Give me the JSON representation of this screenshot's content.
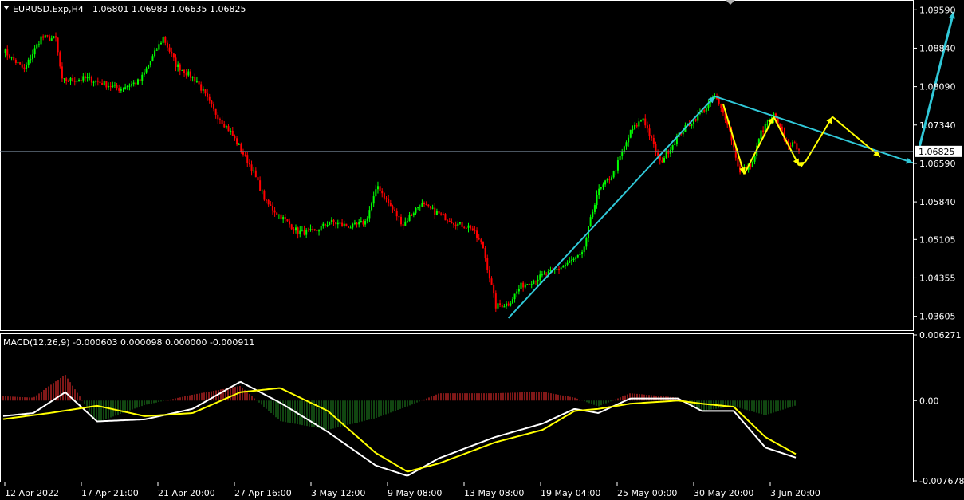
{
  "header": {
    "symbol": "EURUSD.Exp,H4",
    "ohlc": "1.06801 1.06983 1.06635 1.06825"
  },
  "macd_header": {
    "label": "MACD(12,26,9) -0.000603 0.000098 0.000000 -0.000911"
  },
  "colors": {
    "background": "#000000",
    "frame": "#ffffff",
    "bull": "#00ff00",
    "bear": "#ff0000",
    "bid_line": "#778899",
    "trend_cyan": "#30c8d8",
    "zigzag_yellow": "#ffff00",
    "macd_line": "#ffffff",
    "signal_line": "#ffff00",
    "hist_pos": "#ff3030",
    "hist_neg": "#228b22"
  },
  "chart_data": [
    {
      "type": "candlestick",
      "title": "EURUSD.Exp,H4",
      "ylim": [
        1.0335,
        1.0975
      ],
      "y_ticks": [
        "1.09590",
        "1.08840",
        "1.08090",
        "1.07340",
        "1.06590",
        "1.05840",
        "1.05105",
        "1.04355",
        "1.03605"
      ],
      "current_price": "1.06825",
      "x_ticks": [
        "12 Apr 2022",
        "17 Apr 21:00",
        "21 Apr 20:00",
        "27 Apr 16:00",
        "3 May 12:00",
        "9 May 08:00",
        "13 May 08:00",
        "19 May 04:00",
        "25 May 00:00",
        "30 May 20:00",
        "3 Jun 20:00"
      ],
      "bars_count": 250,
      "close_path": [
        [
          0,
          1.088
        ],
        [
          10,
          1.0842
        ],
        [
          18,
          1.0905
        ],
        [
          25,
          1.0902
        ],
        [
          28,
          1.082
        ],
        [
          40,
          1.0825
        ],
        [
          55,
          1.0805
        ],
        [
          65,
          1.082
        ],
        [
          76,
          1.0905
        ],
        [
          82,
          1.0852
        ],
        [
          92,
          1.082
        ],
        [
          100,
          1.0762
        ],
        [
          108,
          1.072
        ],
        [
          118,
          1.065
        ],
        [
          125,
          1.0582
        ],
        [
          132,
          1.0555
        ],
        [
          140,
          1.0525
        ],
        [
          148,
          1.0525
        ],
        [
          155,
          1.0545
        ],
        [
          160,
          1.054
        ],
        [
          166,
          1.0535
        ],
        [
          172,
          1.0545
        ],
        [
          178,
          1.0615
        ],
        [
          184,
          1.0575
        ],
        [
          190,
          1.054
        ],
        [
          198,
          1.058
        ],
        [
          208,
          1.0558
        ],
        [
          216,
          1.054
        ],
        [
          222,
          1.0535
        ],
        [
          228,
          1.0495
        ],
        [
          234,
          1.038
        ],
        [
          240,
          1.0385
        ],
        [
          246,
          1.042
        ]
      ],
      "close_path_note_free": true
    },
    {
      "type": "line",
      "title": "MACD(12,26,9)",
      "ylim": [
        -0.007678,
        0.006271
      ],
      "y_ticks": [
        "0.006271",
        "0.00",
        "-0.007678"
      ],
      "series": [
        {
          "name": "",
          "role": "macd",
          "points": [
            [
              0.0,
              -0.0015
            ],
            [
              0.04,
              -0.0012
            ],
            [
              0.08,
              0.0008
            ],
            [
              0.12,
              -0.002
            ],
            [
              0.18,
              -0.0018
            ],
            [
              0.24,
              -0.0008
            ],
            [
              0.3,
              0.0018
            ],
            [
              0.35,
              -0.0002
            ],
            [
              0.41,
              -0.003
            ],
            [
              0.47,
              -0.0062
            ],
            [
              0.51,
              -0.0072
            ],
            [
              0.55,
              -0.0055
            ],
            [
              0.62,
              -0.0035
            ],
            [
              0.68,
              -0.0022
            ],
            [
              0.72,
              -0.0008
            ],
            [
              0.75,
              -0.0012
            ],
            [
              0.79,
              0.0002
            ],
            [
              0.85,
              0.0002
            ],
            [
              0.88,
              -0.001
            ],
            [
              0.92,
              -0.001
            ],
            [
              0.96,
              -0.0045
            ],
            [
              1.0,
              -0.0055
            ]
          ]
        },
        {
          "name": "",
          "role": "signal",
          "points": [
            [
              0.0,
              -0.0018
            ],
            [
              0.06,
              -0.0012
            ],
            [
              0.12,
              -0.0005
            ],
            [
              0.18,
              -0.0015
            ],
            [
              0.24,
              -0.0012
            ],
            [
              0.3,
              0.0008
            ],
            [
              0.35,
              0.0012
            ],
            [
              0.41,
              -0.001
            ],
            [
              0.47,
              -0.005
            ],
            [
              0.51,
              -0.0068
            ],
            [
              0.55,
              -0.006
            ],
            [
              0.62,
              -0.004
            ],
            [
              0.68,
              -0.0028
            ],
            [
              0.72,
              -0.001
            ],
            [
              0.75,
              -0.0008
            ],
            [
              0.79,
              -0.0003
            ],
            [
              0.85,
              0.0
            ],
            [
              0.88,
              -0.0003
            ],
            [
              0.92,
              -0.0006
            ],
            [
              0.96,
              -0.0035
            ],
            [
              1.0,
              -0.0052
            ]
          ]
        }
      ],
      "histogram_note_free": true
    }
  ]
}
